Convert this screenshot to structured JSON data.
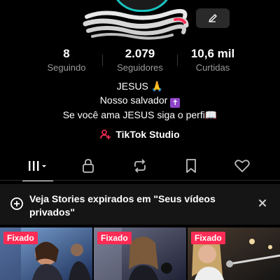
{
  "profile": {
    "edit_icon": "pencil-icon"
  },
  "stats": [
    {
      "value": "8",
      "label": "Seguindo"
    },
    {
      "value": "2.079",
      "label": "Seguidores"
    },
    {
      "value": "10,6 mil",
      "label": "Curtidas"
    }
  ],
  "bio": {
    "line1": "JESUS",
    "line1_emoji": "🙏",
    "line2": "Nosso salvador",
    "line2_emoji": "✝",
    "line3": "Se você ama JESUS siga o perfi",
    "line3_emoji": "📖"
  },
  "studio": {
    "label": "TikTok Studio",
    "icon": "tiktok-studio-icon"
  },
  "tabs": [
    {
      "icon": "grid-videos-icon",
      "active": true
    },
    {
      "icon": "lock-icon"
    },
    {
      "icon": "repost-icon"
    },
    {
      "icon": "bookmark-icon"
    },
    {
      "icon": "heart-icon"
    }
  ],
  "banner": {
    "text": "Veja Stories expirados em \"Seus vídeos privados\""
  },
  "videos": [
    {
      "badge": "Fixado"
    },
    {
      "badge": "Fixado"
    },
    {
      "badge": "Fixado"
    }
  ],
  "colors": {
    "accent": "#fe2c55",
    "background": "#000000",
    "muted_text": "#9a9a9a"
  }
}
